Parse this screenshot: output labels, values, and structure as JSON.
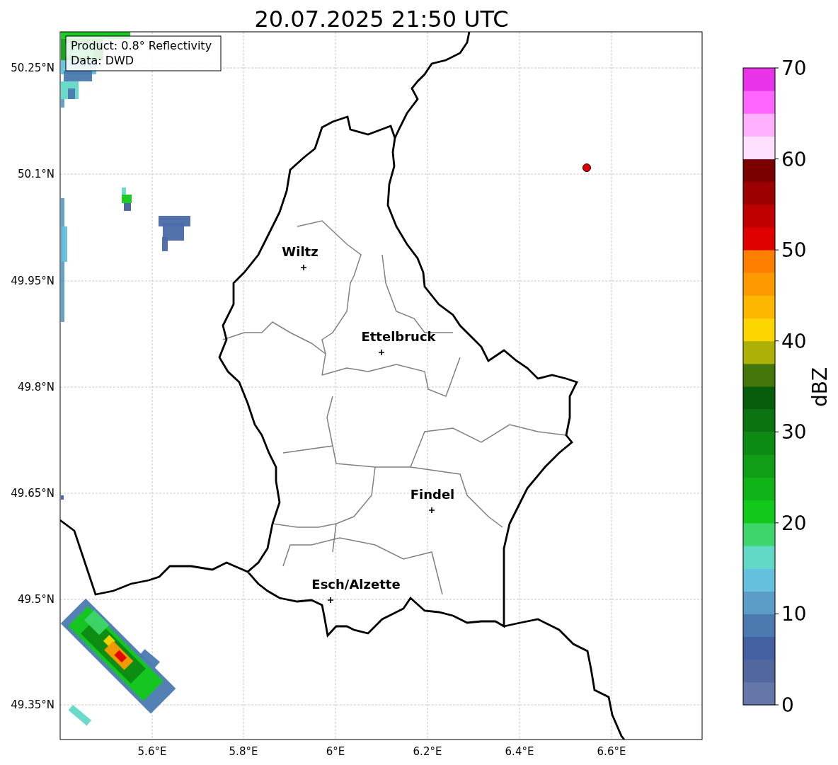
{
  "title": "20.07.2025 21:50 UTC",
  "info_box": {
    "lines": [
      "Product: 0.8° Reflectivity",
      "Data: DWD"
    ]
  },
  "map": {
    "y_tick_labels": [
      "50.25°N",
      "50.1°N",
      "49.95°N",
      "49.8°N",
      "49.65°N",
      "49.5°N",
      "49.35°N"
    ],
    "x_tick_labels": [
      "5.6°E",
      "5.8°E",
      "6°E",
      "6.2°E",
      "6.4°E",
      "6.6°E"
    ],
    "cities": [
      {
        "name": "Wiltz"
      },
      {
        "name": "Ettelbruck"
      },
      {
        "name": "Findel"
      },
      {
        "name": "Esch/Alzette"
      }
    ]
  },
  "colorbar": {
    "label": "dBZ",
    "tick_labels": [
      "70",
      "60",
      "50",
      "40",
      "30",
      "20",
      "10",
      "0"
    ],
    "bins": [
      {
        "color": "#6577a8"
      },
      {
        "color": "#52679e"
      },
      {
        "color": "#4560a0"
      },
      {
        "color": "#4a7ab0"
      },
      {
        "color": "#5b9dc6"
      },
      {
        "color": "#64c0dc"
      },
      {
        "color": "#62d8c6"
      },
      {
        "color": "#3ed56a"
      },
      {
        "color": "#12c81a"
      },
      {
        "color": "#10b418"
      },
      {
        "color": "#0f9e15"
      },
      {
        "color": "#0d8a12"
      },
      {
        "color": "#0b7410"
      },
      {
        "color": "#075d0b"
      },
      {
        "color": "#44760a"
      },
      {
        "color": "#acb007"
      },
      {
        "color": "#fdd500"
      },
      {
        "color": "#fdb700"
      },
      {
        "color": "#fe9a00"
      },
      {
        "color": "#fe7f00"
      },
      {
        "color": "#e00000"
      },
      {
        "color": "#c00000"
      },
      {
        "color": "#9c0000"
      },
      {
        "color": "#7a0000"
      },
      {
        "color": "#ffe0ff"
      },
      {
        "color": "#ffb0ff"
      },
      {
        "color": "#ff66ff"
      },
      {
        "color": "#e833e8"
      }
    ]
  }
}
